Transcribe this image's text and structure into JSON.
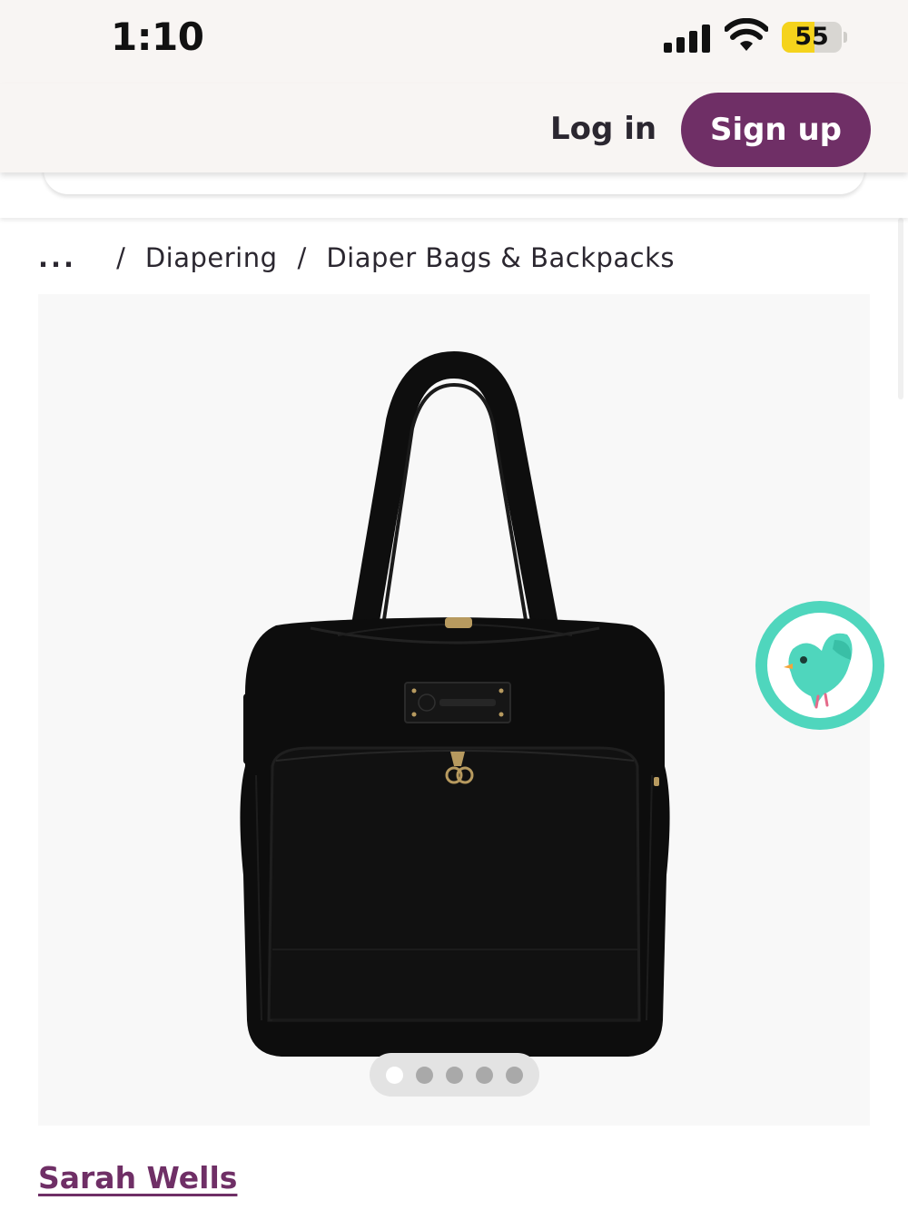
{
  "status_bar": {
    "time": "1:10",
    "battery": "55",
    "battery_level": 0.55,
    "icons": [
      "signal-icon",
      "wifi-icon",
      "battery-icon"
    ]
  },
  "header": {
    "login_label": "Log in",
    "signup_label": "Sign up"
  },
  "breadcrumb": {
    "ellipsis": "...",
    "separator": "/",
    "items": [
      {
        "label": "Diapering"
      },
      {
        "label": "Diaper Bags & Backpacks"
      }
    ]
  },
  "gallery": {
    "image_count": 5,
    "active_index": 0
  },
  "product": {
    "brand": "Sarah Wells"
  },
  "colors": {
    "brand_purple": "#6f2f66",
    "header_bg": "#f8f5f3",
    "chat_teal": "#4fd6bd",
    "battery_yellow": "#f5d31c"
  }
}
